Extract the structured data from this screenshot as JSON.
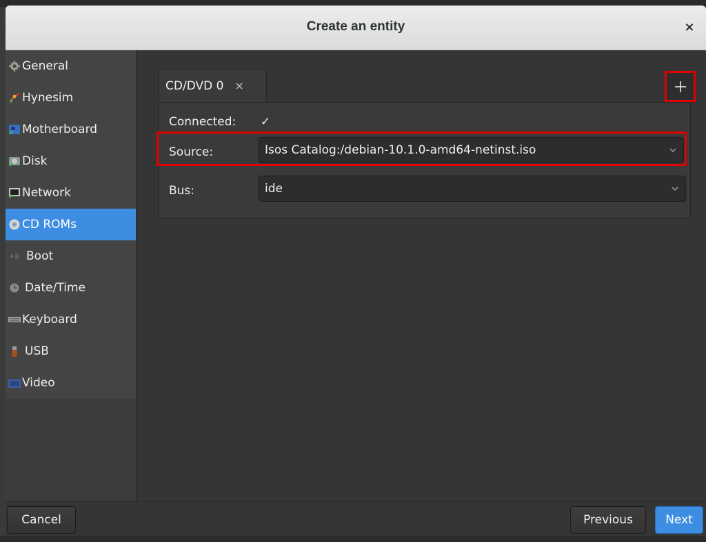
{
  "dialog": {
    "title": "Create an entity",
    "close_symbol": "×"
  },
  "sidebar": {
    "items": [
      {
        "label": "General",
        "icon": "gear-icon"
      },
      {
        "label": "Hynesim",
        "icon": "hynesim-icon"
      },
      {
        "label": "Motherboard",
        "icon": "motherboard-icon"
      },
      {
        "label": "Disk",
        "icon": "disk-icon"
      },
      {
        "label": "Network",
        "icon": "network-icon"
      },
      {
        "label": "CD ROMs",
        "icon": "cdrom-icon",
        "active": true
      },
      {
        "label": "Boot",
        "icon": "boot-icon"
      },
      {
        "label": "Date/Time",
        "icon": "clock-icon"
      },
      {
        "label": "Keyboard",
        "icon": "keyboard-icon"
      },
      {
        "label": "USB",
        "icon": "usb-icon"
      },
      {
        "label": "Video",
        "icon": "video-icon"
      }
    ]
  },
  "tabs": [
    {
      "label": "CD/DVD 0",
      "close_symbol": "×"
    }
  ],
  "form": {
    "connected_label": "Connected:",
    "connected_check": "✓",
    "source_label": "Source:",
    "source_value": "Isos Catalog:/debian-10.1.0-amd64-netinst.iso",
    "bus_label": "Bus:",
    "bus_value": "ide"
  },
  "footer": {
    "cancel_label": "Cancel",
    "previous_label": "Previous",
    "next_label": "Next"
  },
  "colors": {
    "accent": "#3d8ee2",
    "highlight": "#e00000"
  }
}
